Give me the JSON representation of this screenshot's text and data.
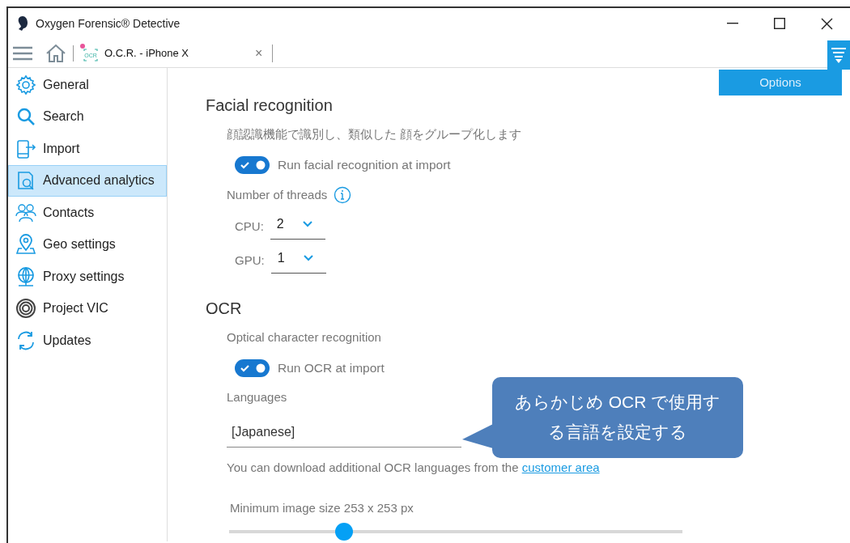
{
  "window": {
    "title": "Oxygen Forensic® Detective"
  },
  "tab": {
    "icon_text": "OCR",
    "label": "O.C.R. - iPhone X",
    "close": "×"
  },
  "options_menu": {
    "label": "Options"
  },
  "sidebar": {
    "items": [
      {
        "label": "General",
        "selected": false
      },
      {
        "label": "Search",
        "selected": false
      },
      {
        "label": "Import",
        "selected": false
      },
      {
        "label": "Advanced analytics",
        "selected": true
      },
      {
        "label": "Contacts",
        "selected": false
      },
      {
        "label": "Geo settings",
        "selected": false
      },
      {
        "label": "Proxy settings",
        "selected": false
      },
      {
        "label": "Project VIC",
        "selected": false
      },
      {
        "label": "Updates",
        "selected": false
      }
    ]
  },
  "facial_recognition": {
    "title": "Facial recognition",
    "description": "顔認識機能で識別し、類似した 顔をグループ化します",
    "toggle": {
      "label": "Run facial recognition at import",
      "on": true
    },
    "threads_label": "Number of threads",
    "selects": [
      {
        "label": "CPU:",
        "value": "2"
      },
      {
        "label": "GPU:",
        "value": "1"
      }
    ]
  },
  "ocr": {
    "title": "OCR",
    "description": "Optical character recognition",
    "toggle": {
      "label": "Run OCR at import",
      "on": true
    },
    "languages_label": "Languages",
    "languages_value": "[Japanese]",
    "hint": "You can download additional OCR languages from the",
    "hint_link": "customer area",
    "size_label": "Minimum image size 253 x 253 px",
    "size_slider": {
      "level": 0.254
    }
  },
  "callout": {
    "text": "あらかじめ OCR で使用する言語を設定する"
  }
}
